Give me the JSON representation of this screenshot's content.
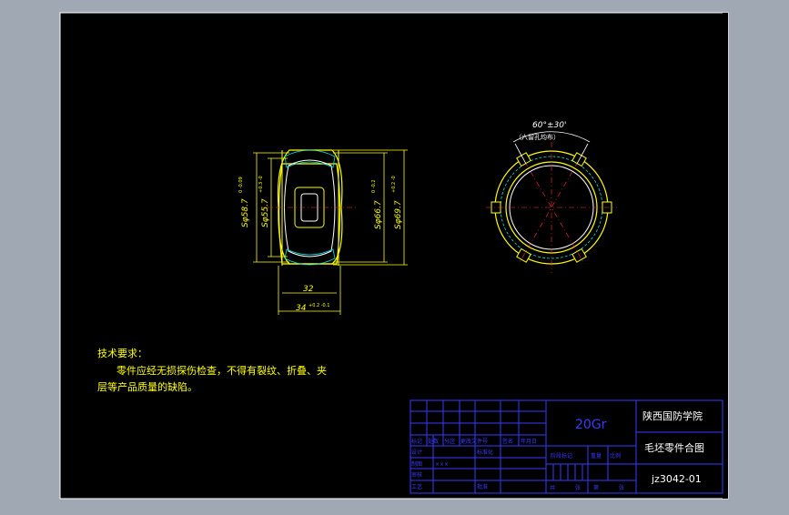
{
  "drawing": {
    "dimensions": {
      "left_sphere_outer": "Sφ58.7",
      "left_sphere_outer_tol": "0\n-0.09",
      "left_sphere_inner": "Sφ55.7",
      "left_sphere_inner_tol": "+0.3\n-0",
      "right_sphere_inner": "Sφ66.7",
      "right_sphere_inner_tol": "0\n-0.2",
      "right_sphere_outer": "Sφ69.7",
      "right_sphere_outer_tol": "+0.2\n-0",
      "width_inner": "32",
      "width_outer": "34",
      "width_outer_tol": "+0.2\n-0.1",
      "angle": "60°±30'",
      "angle_note": "（六留孔均布）"
    },
    "tech_requirements": {
      "title": "技术要求：",
      "line1": "零件应经无损探伤检查，不得有裂纹、折叠、夹",
      "line2": "层等产品质量的缺陷。"
    },
    "title_block": {
      "material": "20Gr",
      "school": "陕西国防学院",
      "drawing_name": "毛坯零件合图",
      "drawing_no": "jz3042-01",
      "row_labels": [
        "标记",
        "处数",
        "分区",
        "更改文件号",
        "签名",
        "年月日"
      ],
      "design": "设计",
      "standardization": "标准化",
      "drafter": "制图",
      "check": "审核",
      "process": "工艺",
      "approve": "批准",
      "stage_mark": "阶段标记",
      "weight": "重量",
      "scale": "比例",
      "sheets": "共",
      "sheet": "张",
      "sheet_no": "第",
      "drafter_name": "×××"
    }
  },
  "colors": {
    "frame_bg": "#000000",
    "outline": "#ffffff",
    "part": "#ffff00",
    "hatch": "#00e5e5",
    "center": "#ff3030",
    "title_block": "#3a3aff",
    "text_white": "#ffffff"
  }
}
